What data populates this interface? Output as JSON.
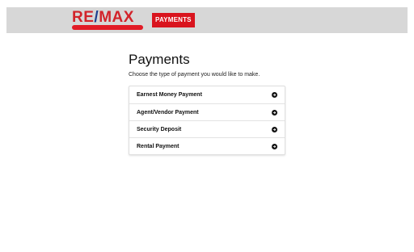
{
  "header": {
    "logo": {
      "part1": "RE",
      "slash": "/",
      "part2": "MAX"
    },
    "badge": "PAYMENTS"
  },
  "page": {
    "title": "Payments",
    "subtitle": "Choose the type of payment you would like to make."
  },
  "payment_options": [
    {
      "label": "Earnest Money Payment",
      "icon": "arrow-circle-right-icon"
    },
    {
      "label": "Agent/Vendor Payment",
      "icon": "arrow-circle-right-icon"
    },
    {
      "label": "Security Deposit",
      "icon": "arrow-circle-right-icon"
    },
    {
      "label": "Rental Payment",
      "icon": "arrow-circle-right-icon"
    }
  ],
  "colors": {
    "brand_red": "#d2232a",
    "brand_blue": "#1d3f8f",
    "header_bg": "#d7d7d7",
    "badge_bg": "#d9141e"
  }
}
